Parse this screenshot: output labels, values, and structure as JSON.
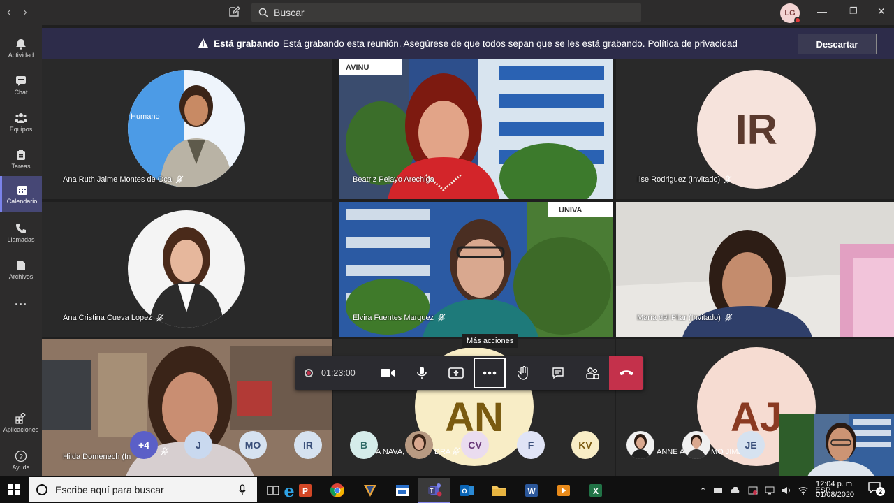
{
  "titlebar": {
    "search_placeholder": "Buscar",
    "user_initials": "LG"
  },
  "rail": [
    {
      "label": "Actividad",
      "icon": "bell-icon"
    },
    {
      "label": "Chat",
      "icon": "chat-icon"
    },
    {
      "label": "Equipos",
      "icon": "teams-icon"
    },
    {
      "label": "Tareas",
      "icon": "tasks-icon"
    },
    {
      "label": "Calendario",
      "icon": "calendar-icon",
      "active": true
    },
    {
      "label": "Llamadas",
      "icon": "phone-icon"
    },
    {
      "label": "Archivos",
      "icon": "file-icon"
    },
    {
      "label": "Aplicaciones",
      "icon": "apps-icon"
    },
    {
      "label": "Ayuda",
      "icon": "help-icon"
    }
  ],
  "banner": {
    "bold": "Está grabando",
    "text": "Está grabando esta reunión. Asegúrese de que todos sepan que se les está grabando.",
    "link": "Política de privacidad",
    "dismiss": "Descartar"
  },
  "participants": {
    "p1": "Ana Ruth Jaime Montes de Oca",
    "p2": "Beatriz Pelayo Arechiga",
    "p3": "Ilse Rodriguez (Invitado)",
    "p3_initials": "IR",
    "p4": "Ana Cristina Cueva Lopez",
    "p5": "Elvira Fuentes Marquez",
    "p6": "María del Pilar (Invitado)",
    "p7": "Hilda Domenech (In",
    "p8_partial": "A NAVA, ",
    "p8_partial2": "DRA",
    "p8_initials": "AN",
    "p9_initials": "AJ",
    "p9_partial": "ANNE AYL",
    "p9_partial2": "MO JIMEN",
    "logo": "UNIVA"
  },
  "controls": {
    "timer": "01:23:00",
    "tooltip": "Más acciones"
  },
  "strip": [
    "+4",
    "J",
    "MO",
    "IR",
    "B",
    "CV",
    "F",
    "KV",
    "JE"
  ],
  "taskbar": {
    "search": "Escribe aquí para buscar",
    "lang": "ESP",
    "time": "12:04 p. m.",
    "date": "01/08/2020",
    "notif": "2"
  }
}
